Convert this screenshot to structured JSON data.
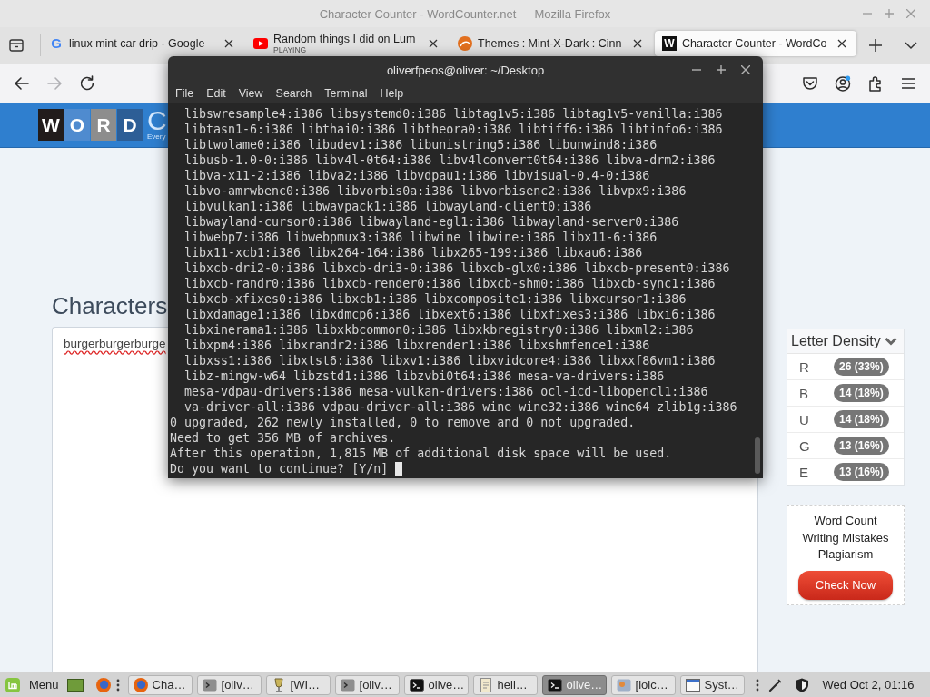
{
  "firefox": {
    "title": "Character Counter - WordCounter.net — Mozilla Firefox",
    "tabs": [
      {
        "title": "linux mint car drip - Google",
        "kind": "letter",
        "icon_text": "G",
        "selected": false
      },
      {
        "title": "Random things I did on Lum",
        "status": "PLAYING",
        "kind": "play",
        "selected": false
      },
      {
        "title": "Themes : Mint-X-Dark : Cinn",
        "kind": "swirl",
        "selected": false
      },
      {
        "title": "Character Counter - WordCo",
        "kind": "tile",
        "icon_text": "W",
        "selected": true
      }
    ],
    "nav": [
      {
        "kind": "back",
        "disabled": false
      },
      {
        "kind": "forward",
        "disabled": true
      },
      {
        "kind": "reload",
        "disabled": false
      }
    ]
  },
  "page": {
    "logo": {
      "tiles": [
        {
          "letter": "W",
          "color": "#221c1c"
        },
        {
          "letter": "O",
          "color": "#4f8bcf"
        },
        {
          "letter": "R",
          "color": "#8d8d8d"
        },
        {
          "letter": "D",
          "color": "#2d5e96"
        }
      ],
      "name": "C",
      "tagline": "Every"
    },
    "heading": "Characters",
    "editor": {
      "value": "burgerburgerburge",
      "misspelled": true
    },
    "letter_density": {
      "title": "Letter Density",
      "rows": [
        {
          "letter": "R",
          "count": "26 (33%)"
        },
        {
          "letter": "B",
          "count": "14 (18%)"
        },
        {
          "letter": "U",
          "count": "14 (18%)"
        },
        {
          "letter": "G",
          "count": "13 (16%)"
        },
        {
          "letter": "E",
          "count": "13 (16%)"
        }
      ]
    },
    "promo": {
      "lines": [
        "Word Count",
        "Writing Mistakes",
        "Plagiarism"
      ],
      "button": "Check Now"
    }
  },
  "terminal": {
    "title": "oliverfpeos@oliver: ~/Desktop",
    "menu": [
      "File",
      "Edit",
      "View",
      "Search",
      "Terminal",
      "Help"
    ],
    "lines": [
      "  libswresample4:i386 libsystemd0:i386 libtag1v5:i386 libtag1v5-vanilla:i386",
      "  libtasn1-6:i386 libthai0:i386 libtheora0:i386 libtiff6:i386 libtinfo6:i386",
      "  libtwolame0:i386 libudev1:i386 libunistring5:i386 libunwind8:i386",
      "  libusb-1.0-0:i386 libv4l-0t64:i386 libv4lconvert0t64:i386 libva-drm2:i386",
      "  libva-x11-2:i386 libva2:i386 libvdpau1:i386 libvisual-0.4-0:i386",
      "  libvo-amrwbenc0:i386 libvorbis0a:i386 libvorbisenc2:i386 libvpx9:i386",
      "  libvulkan1:i386 libwavpack1:i386 libwayland-client0:i386",
      "  libwayland-cursor0:i386 libwayland-egl1:i386 libwayland-server0:i386",
      "  libwebp7:i386 libwebpmux3:i386 libwine libwine:i386 libx11-6:i386",
      "  libx11-xcb1:i386 libx264-164:i386 libx265-199:i386 libxau6:i386",
      "  libxcb-dri2-0:i386 libxcb-dri3-0:i386 libxcb-glx0:i386 libxcb-present0:i386",
      "  libxcb-randr0:i386 libxcb-render0:i386 libxcb-shm0:i386 libxcb-sync1:i386",
      "  libxcb-xfixes0:i386 libxcb1:i386 libxcomposite1:i386 libxcursor1:i386",
      "  libxdamage1:i386 libxdmcp6:i386 libxext6:i386 libxfixes3:i386 libxi6:i386",
      "  libxinerama1:i386 libxkbcommon0:i386 libxkbregistry0:i386 libxml2:i386",
      "  libxpm4:i386 libxrandr2:i386 libxrender1:i386 libxshmfence1:i386",
      "  libxss1:i386 libxtst6:i386 libxv1:i386 libxvidcore4:i386 libxxf86vm1:i386",
      "  libz-mingw-w64 libzstd1:i386 libzvbi0t64:i386 mesa-va-drivers:i386",
      "  mesa-vdpau-drivers:i386 mesa-vulkan-drivers:i386 ocl-icd-libopencl1:i386",
      "  va-driver-all:i386 vdpau-driver-all:i386 wine wine32:i386 wine64 zlib1g:i386",
      "0 upgraded, 262 newly installed, 0 to remove and 0 not upgraded.",
      "Need to get 356 MB of archives.",
      "After this operation, 1,815 MB of additional disk space will be used.",
      "Do you want to continue? [Y/n]"
    ]
  },
  "taskbar": {
    "menu_label": "Menu",
    "windows": [
      {
        "label": "Cha…",
        "kind": "browser",
        "selected": false
      },
      {
        "label": "[oliv…",
        "kind": "terminal-dim",
        "selected": false
      },
      {
        "label": "[WI…",
        "kind": "wine",
        "selected": false
      },
      {
        "label": "[oliv…",
        "kind": "terminal-dim",
        "selected": false
      },
      {
        "label": "olive…",
        "kind": "terminal",
        "selected": false
      },
      {
        "label": "hell…",
        "kind": "notes",
        "selected": false
      },
      {
        "label": "olive…",
        "kind": "terminal",
        "selected": true
      },
      {
        "label": "[lolc…",
        "kind": "image",
        "selected": false
      },
      {
        "label": "Syst…",
        "kind": "window",
        "selected": false
      }
    ],
    "clock": "Wed Oct 2, 01:16"
  }
}
